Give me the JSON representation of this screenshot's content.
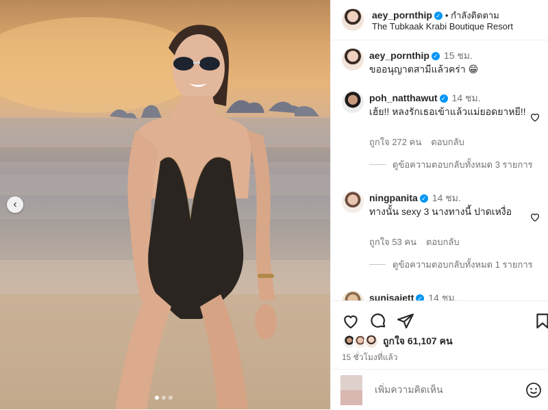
{
  "post_header": {
    "username": "aey_pornthip",
    "follow_label": "• กำลังติดตาม",
    "location": "The Tubkaak Krabi Boutique Resort"
  },
  "caption": {
    "username": "aey_pornthip",
    "time": "15 ชม.",
    "text": "ขออนุญาตสามีแล้วคร่า 😁"
  },
  "comments": [
    {
      "username": "poh_natthawut",
      "time": "14 ชม.",
      "text": "เฮ้ย!! หลงรักเธอเข้าแล้วแม่ยอดยาหยี!!",
      "likes": "ถูกใจ 272 คน",
      "reply": "ตอบกลับ",
      "view_replies": "ดูข้อความตอบกลับทั้งหมด 3 รายการ"
    },
    {
      "username": "ningpanita",
      "time": "14 ชม.",
      "text": "ทางนั้น sexy 3 นางทางนี้ ปาดเหงื่อ",
      "likes": "ถูกใจ 53 คน",
      "reply": "ตอบกลับ",
      "view_replies": "ดูข้อความตอบกลับทั้งหมด 1 รายการ"
    },
    {
      "username": "sunisajett",
      "time": "14 ชม."
    }
  ],
  "likes_summary": "ถูกใจ 61,107 คน",
  "post_time": "15 ชั่วโมงที่แล้ว",
  "add_comment": {
    "placeholder": "เพิ่มความคิดเห็น"
  },
  "colors": {
    "verified": "#0095f6",
    "text": "#262626",
    "muted": "#737373"
  },
  "icons": [
    "chevron-left-icon",
    "heart-icon",
    "comment-icon",
    "share-icon",
    "bookmark-icon",
    "emoji-icon",
    "verified-badge-icon"
  ]
}
